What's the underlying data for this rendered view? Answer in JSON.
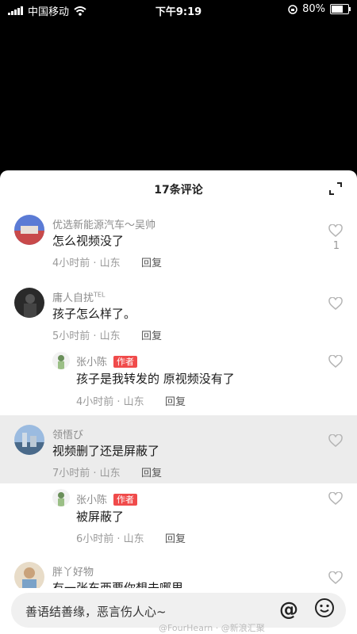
{
  "status_bar": {
    "carrier": "中国移动",
    "time": "下午9:19",
    "battery_percent": "80%",
    "battery_level": 0.8
  },
  "sheet": {
    "title": "17条评论"
  },
  "comments": [
    {
      "user": "优选新能源汽车～吴帅",
      "text": "怎么视频没了",
      "meta": "4小时前 · 山东",
      "reply_label": "回复",
      "likes": "1"
    },
    {
      "user": "庸人自扰",
      "user_suffix": "TEL",
      "text": "孩子怎么样了。",
      "meta": "5小时前 · 山东",
      "reply_label": "回复",
      "replies": [
        {
          "user": "张小陈",
          "badge": "作者",
          "text": "孩子是我转发的 原视频没有了",
          "meta": "4小时前 · 山东",
          "reply_label": "回复"
        }
      ]
    },
    {
      "user": "领悟び",
      "text": "视频删了还是屏蔽了",
      "meta": "7小时前 · 山东",
      "reply_label": "回复",
      "replies": [
        {
          "user": "张小陈",
          "badge": "作者",
          "text": "被屏蔽了",
          "meta": "6小时前 · 山东",
          "reply_label": "回复"
        }
      ]
    },
    {
      "user": "胖丫好物",
      "text": "有一张东西要你想去哪里"
    }
  ],
  "input": {
    "placeholder": "善语结善缘，恶言伤人心~"
  },
  "icons": {
    "expand": "expand-icon",
    "heart": "heart-icon",
    "mention": "at-icon",
    "emoji": "emoji-icon"
  },
  "watermark": "@FourHearn · @新浪汇聚"
}
